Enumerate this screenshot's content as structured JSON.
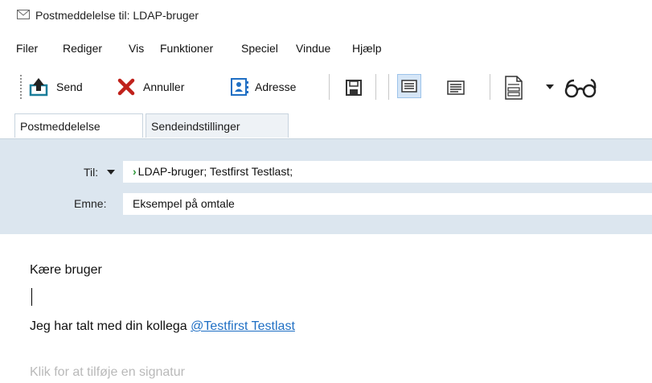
{
  "window": {
    "title": "Postmeddelelse til: LDAP-bruger",
    "icon": "envelope-icon"
  },
  "menu": [
    "Filer",
    "Rediger",
    "Vis",
    "Funktioner",
    "Speciel",
    "Vindue",
    "Hjælp"
  ],
  "toolbar": {
    "send_label": "Send",
    "cancel_label": "Annuller",
    "address_label": "Adresse",
    "icons": [
      "send-icon",
      "cancel-x-icon",
      "address-book-icon",
      "save-icon",
      "plain-text-icon",
      "formatted-text-icon",
      "template-icon",
      "dropdown-arrow-icon",
      "spectacles-icon"
    ]
  },
  "tabs": [
    {
      "label": "Postmeddelelse",
      "active": true
    },
    {
      "label": "Sendeindstillinger",
      "active": false
    }
  ],
  "header": {
    "to_label": "Til:",
    "to_value": "LDAP-bruger;  Testfirst Testlast;",
    "subject_label": "Emne:",
    "subject_value": "Eksempel på omtale"
  },
  "body": {
    "greeting": "Kære bruger",
    "line_prefix": "Jeg har talt med din kollega ",
    "mention": "@Testfirst  Testlast",
    "signature_placeholder": "Klik for at tilføje en signatur"
  },
  "colors": {
    "header_panel": "#dce6ef",
    "mention": "#1f6fc4",
    "cancel_red": "#c0211b",
    "send_teal": "#1a7d99"
  }
}
